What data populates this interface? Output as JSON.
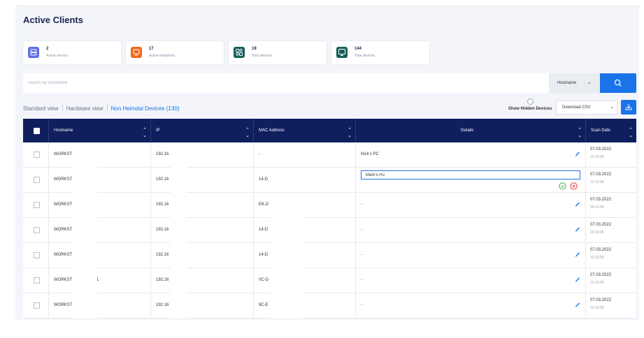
{
  "page": {
    "title": "Active Clients"
  },
  "cards": [
    {
      "value": "2",
      "label": "Active servers",
      "icon": "servers-icon",
      "color": "#5f6ee0"
    },
    {
      "value": "17",
      "label": "Active endpoints",
      "icon": "monitor-icon",
      "color": "#f06a1d"
    },
    {
      "value": "19",
      "label": "Total devices",
      "icon": "devices-icon",
      "color": "#175e5a"
    },
    {
      "value": "144",
      "label": "Total devices",
      "icon": "monitor-icon",
      "color": "#175e5a"
    }
  ],
  "search": {
    "placeholder": "Search by Hostname",
    "value": "",
    "filter": "Hostname"
  },
  "views": {
    "standard": "Standard view",
    "hardware": "Hardware view",
    "non_heimdal": "Non Heimdal Devices (130)"
  },
  "toolbar": {
    "show_hidden": "Show Hidden Devices",
    "download": "Download CSV"
  },
  "table": {
    "columns": [
      "Hostname",
      "IP",
      "MAC Address",
      "Details",
      "Scan Date"
    ],
    "rows": [
      {
        "hostname": "WORKST",
        "ip": "192.16",
        "mac": "-",
        "details": "Nick's PC",
        "date": "07.03.2022",
        "time": "16:13:39"
      },
      {
        "hostname": "WORKST",
        "ip": "192.16",
        "mac": "14-D",
        "details": "Mark's PC",
        "date": "07.03.2022",
        "time": "16:13:39",
        "editing": true
      },
      {
        "hostname": "WORKST",
        "ip": "192.16",
        "mac": "E8-2/",
        "details": "-",
        "date": "07.03.2022",
        "time": "16:13:39"
      },
      {
        "hostname": "WORKST",
        "ip": "192.16",
        "mac": "14-D",
        "details": "-",
        "date": "07.03.2022",
        "time": "16:13:39"
      },
      {
        "hostname": "WORKST",
        "ip": "192.16",
        "mac": "14-D",
        "details": "-",
        "date": "07.03.2022",
        "time": "16:13:39"
      },
      {
        "hostname": "WORKST",
        "hostname_suffix": "1",
        "ip": "192.16",
        "mac": "0C-D",
        "details": "-",
        "date": "07.03.2022",
        "time": "16:13:39"
      },
      {
        "hostname": "WORKST",
        "ip": "192.16",
        "mac": "9C-E",
        "details": "-",
        "date": "07.03.2022",
        "time": "16:13:39"
      }
    ]
  },
  "colors": {
    "header": "#0f1f5e",
    "accent": "#1a73e8",
    "ok": "#3fb24f",
    "cancel": "#e53935"
  }
}
